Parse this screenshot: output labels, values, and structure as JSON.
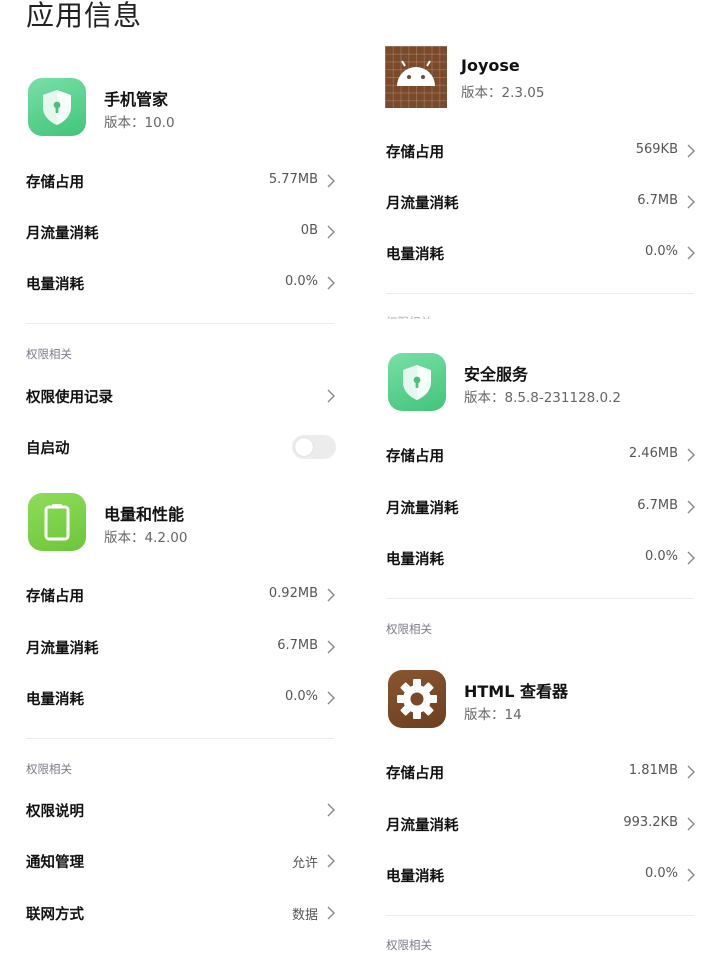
{
  "page_title": "应用信息",
  "left": {
    "app1": {
      "name": "手机管家",
      "version": "版本：10.0",
      "icon": "shield-lock-icon",
      "icon_color": "#5dd18e"
    },
    "app1_rows": [
      {
        "label": "存储占用",
        "value": "5.77MB"
      },
      {
        "label": "月流量消耗",
        "value": "0B"
      },
      {
        "label": "电量消耗",
        "value": "0.0%"
      }
    ],
    "perm_section": "权限相关",
    "perm_rows": [
      {
        "label": "权限使用记录",
        "value": ""
      }
    ],
    "autostart_label": "自启动",
    "autostart_on": false,
    "app2": {
      "name": "电量和性能",
      "version": "版本：4.2.00",
      "icon": "battery-icon",
      "icon_color": "#7ed147"
    },
    "app2_rows": [
      {
        "label": "存储占用",
        "value": "0.92MB"
      },
      {
        "label": "月流量消耗",
        "value": "6.7MB"
      },
      {
        "label": "电量消耗",
        "value": "0.0%"
      }
    ],
    "perm_section2": "权限相关",
    "perm_rows2": [
      {
        "label": "权限说明",
        "value": ""
      },
      {
        "label": "通知管理",
        "value": "允许"
      },
      {
        "label": "联网方式",
        "value": "数据"
      }
    ]
  },
  "right": {
    "app1": {
      "name": "Joyose",
      "version": "版本：2.3.05",
      "icon": "android-icon",
      "icon_color": "#7a4a2a"
    },
    "app1_rows": [
      {
        "label": "存储占用",
        "value": "569KB"
      },
      {
        "label": "月流量消耗",
        "value": "6.7MB"
      },
      {
        "label": "电量消耗",
        "value": "0.0%"
      }
    ],
    "cut_section": "权限相关",
    "app2": {
      "name": "安全服务",
      "version": "版本：8.5.8-231128.0.2",
      "icon": "shield-lock-icon",
      "icon_color": "#5dd18e"
    },
    "app2_rows": [
      {
        "label": "存储占用",
        "value": "2.46MB"
      },
      {
        "label": "月流量消耗",
        "value": "6.7MB"
      },
      {
        "label": "电量消耗",
        "value": "0.0%"
      }
    ],
    "perm_section": "权限相关",
    "app3": {
      "name": "HTML 查看器",
      "version": "版本：14",
      "icon": "gear-icon",
      "icon_color": "#7a4a28"
    },
    "app3_rows": [
      {
        "label": "存储占用",
        "value": "1.81MB"
      },
      {
        "label": "月流量消耗",
        "value": "993.2KB"
      },
      {
        "label": "电量消耗",
        "value": "0.0%"
      }
    ],
    "perm_section2": "权限相关"
  }
}
